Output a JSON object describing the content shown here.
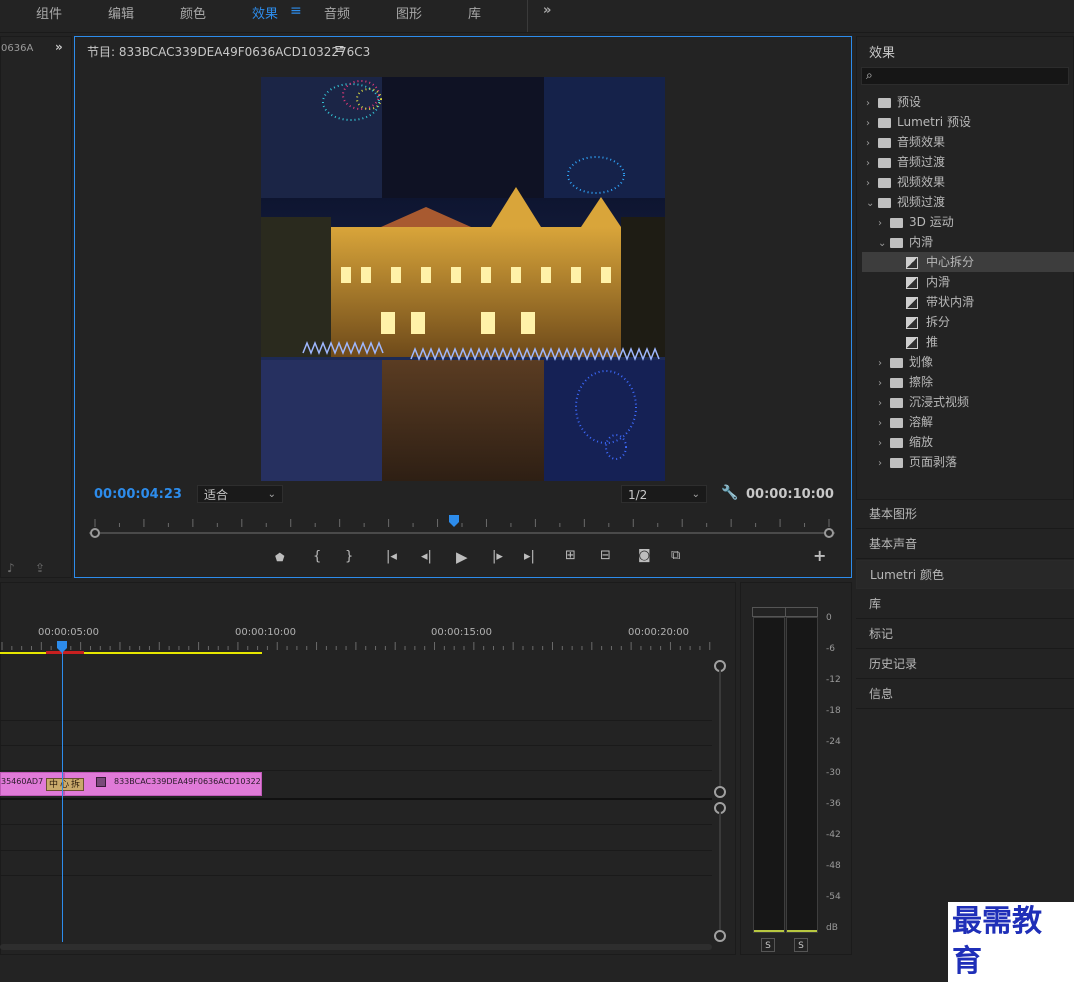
{
  "workspace_tabs": [
    {
      "label": "组件"
    },
    {
      "label": "编辑"
    },
    {
      "label": "颜色"
    },
    {
      "label": "效果"
    },
    {
      "label": "音频"
    },
    {
      "label": "图形"
    },
    {
      "label": "库"
    }
  ],
  "left_panel": {
    "title_fragment": "0636A"
  },
  "program_monitor": {
    "title": "节目: 833BCAC339DEA49F0636ACD1032276C3",
    "current_timecode": "00:00:04:23",
    "fit_value": "适合",
    "resolution_value": "1/2",
    "duration_timecode": "00:00:10:00"
  },
  "effects_panel": {
    "title": "效果",
    "search_placeholder": "",
    "tree": [
      {
        "label": "预设",
        "type": "preset-folder",
        "level": 0,
        "expanded": false
      },
      {
        "label": "Lumetri 预设",
        "type": "preset-folder",
        "level": 0,
        "expanded": false
      },
      {
        "label": "音频效果",
        "type": "folder",
        "level": 0,
        "expanded": false
      },
      {
        "label": "音频过渡",
        "type": "folder",
        "level": 0,
        "expanded": false
      },
      {
        "label": "视频效果",
        "type": "folder",
        "level": 0,
        "expanded": false
      },
      {
        "label": "视频过渡",
        "type": "folder",
        "level": 0,
        "expanded": true
      },
      {
        "label": "3D 运动",
        "type": "folder",
        "level": 1,
        "expanded": false
      },
      {
        "label": "内滑",
        "type": "folder",
        "level": 1,
        "expanded": true
      },
      {
        "label": "中心拆分",
        "type": "effect",
        "level": 2,
        "selected": true
      },
      {
        "label": "内滑",
        "type": "effect",
        "level": 2
      },
      {
        "label": "带状内滑",
        "type": "effect",
        "level": 2
      },
      {
        "label": "拆分",
        "type": "effect",
        "level": 2
      },
      {
        "label": "推",
        "type": "effect",
        "level": 2
      },
      {
        "label": "划像",
        "type": "folder",
        "level": 1,
        "expanded": false
      },
      {
        "label": "擦除",
        "type": "folder",
        "level": 1,
        "expanded": false
      },
      {
        "label": "沉浸式视频",
        "type": "folder",
        "level": 1,
        "expanded": false
      },
      {
        "label": "溶解",
        "type": "folder",
        "level": 1,
        "expanded": false
      },
      {
        "label": "缩放",
        "type": "folder",
        "level": 1,
        "expanded": false
      },
      {
        "label": "页面剥落",
        "type": "folder",
        "level": 1,
        "expanded": false
      }
    ]
  },
  "side_panels": [
    {
      "label": "基本图形"
    },
    {
      "label": "基本声音"
    },
    {
      "label": "Lumetri 颜色"
    },
    {
      "label": "库"
    },
    {
      "label": "标记"
    },
    {
      "label": "历史记录"
    },
    {
      "label": "信息"
    }
  ],
  "timeline": {
    "ruler": [
      "00:00:05:00",
      "00:00:10:00",
      "00:00:15:00",
      "00:00:20:00"
    ],
    "clip_left_label": "35460AD7",
    "transition_label": "中心拆",
    "clip_right_label": "833BCAC339DEA49F0636ACD10322"
  },
  "audio_meter": {
    "scale": [
      "0",
      "-6",
      "-12",
      "-18",
      "-24",
      "-30",
      "-36",
      "-42",
      "-48",
      "-54",
      "dB"
    ],
    "solo_left": "S",
    "solo_right": "S"
  },
  "watermark": "最需教育",
  "colors": {
    "accent": "#2d8ceb",
    "clip": "#e07ad8",
    "transition": "#c8a96b",
    "workarea": "#e6e600"
  }
}
